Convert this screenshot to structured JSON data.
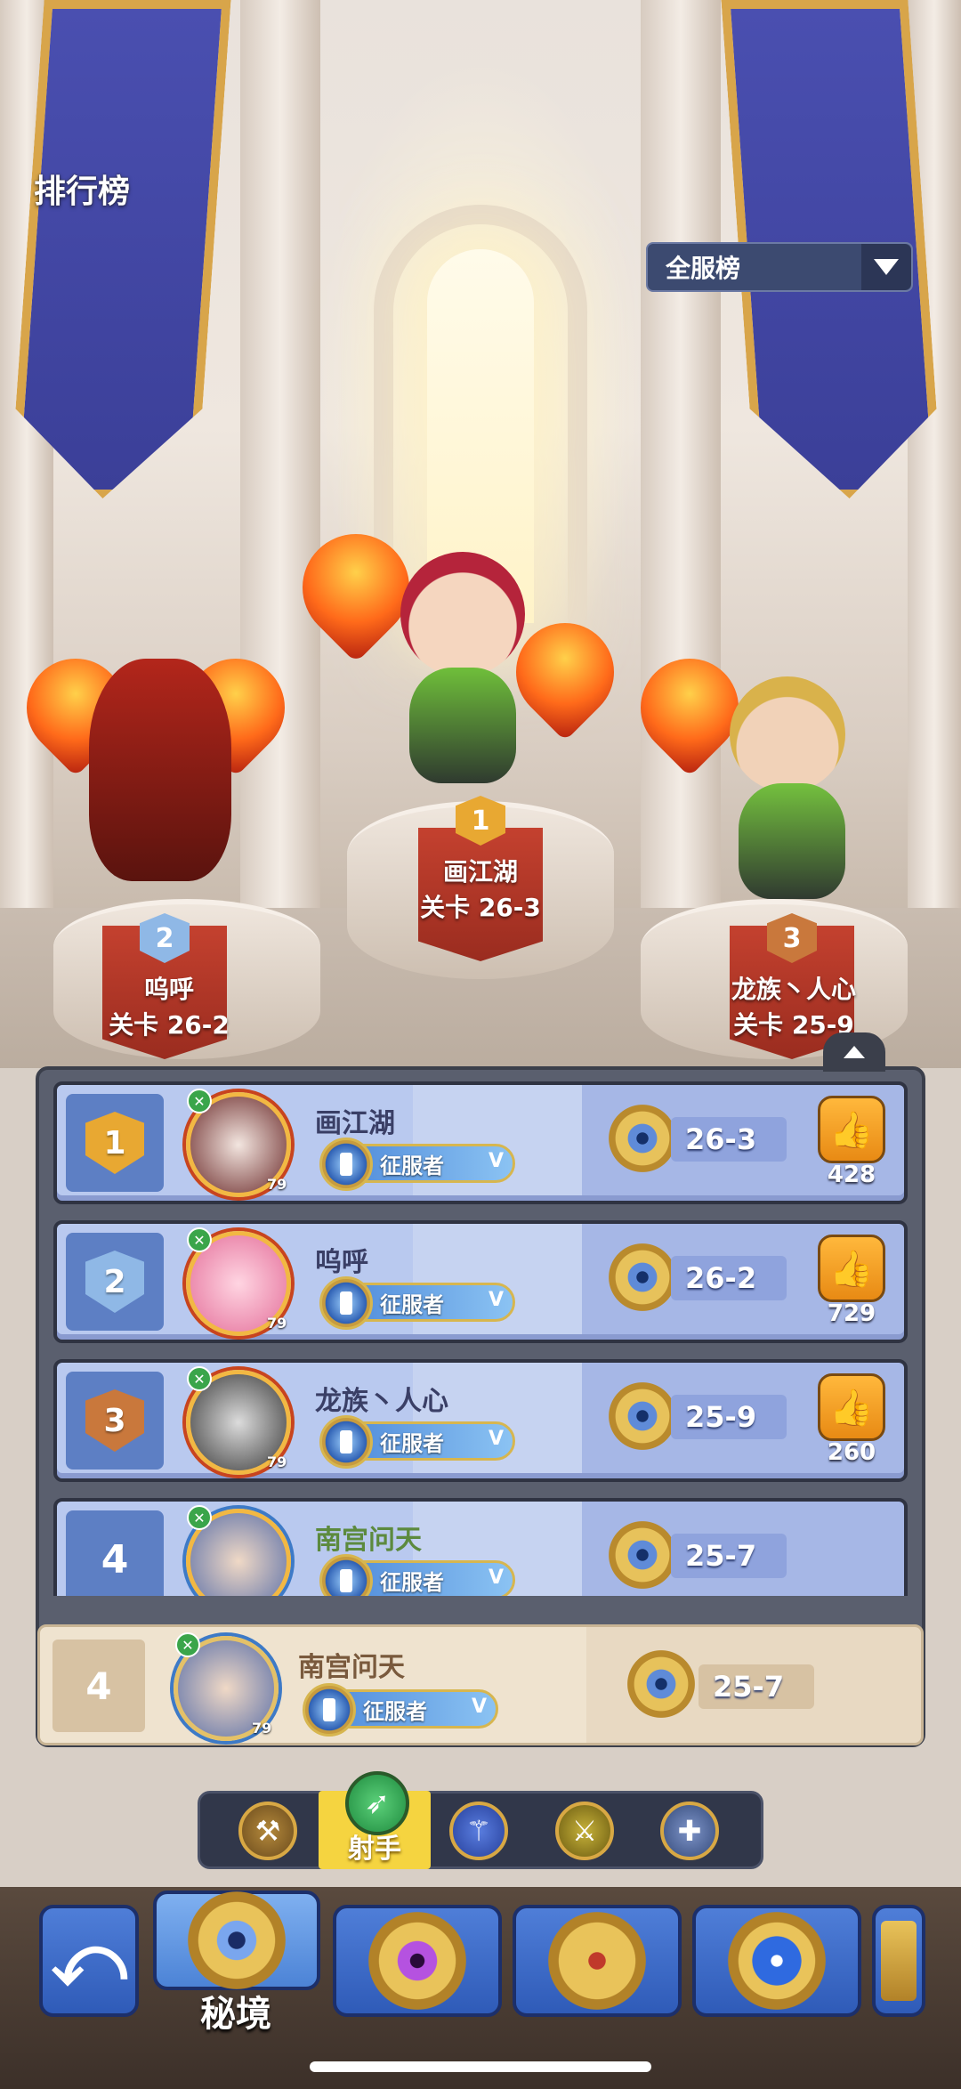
{
  "header": {
    "title": "排行榜",
    "scope_select": {
      "selected": "全服榜"
    }
  },
  "podium": [
    {
      "rank": "1",
      "name": "画江湖",
      "stage": "关卡 26-3"
    },
    {
      "rank": "2",
      "name": "呜呼",
      "stage": "关卡 26-2"
    },
    {
      "rank": "3",
      "name": "龙族丶人心",
      "stage": "关卡 25-9"
    }
  ],
  "rankings": [
    {
      "rank": "1",
      "name": "画江湖",
      "level": "79",
      "title": "征服者",
      "title_tier": "V",
      "stage": "26-3",
      "likes": "428"
    },
    {
      "rank": "2",
      "name": "呜呼",
      "level": "79",
      "title": "征服者",
      "title_tier": "V",
      "stage": "26-2",
      "likes": "729"
    },
    {
      "rank": "3",
      "name": "龙族丶人心",
      "level": "79",
      "title": "征服者",
      "title_tier": "V",
      "stage": "25-9",
      "likes": "260"
    },
    {
      "rank": "4",
      "name": "南宫问天",
      "level": "79",
      "title": "征服者",
      "title_tier": "V",
      "stage": "25-7",
      "likes": ""
    }
  ],
  "self_row": {
    "rank": "4",
    "name": "南宫问天",
    "level": "79",
    "title": "征服者",
    "title_tier": "V",
    "stage": "25-7"
  },
  "class_tabs": {
    "active_label": "射手",
    "tabs": [
      {
        "icon": "axe-icon"
      },
      {
        "icon": "bow-icon",
        "active": true
      },
      {
        "icon": "staff-icon"
      },
      {
        "icon": "sword-icon"
      },
      {
        "icon": "cross-icon"
      }
    ]
  },
  "bottom_nav": {
    "active_label": "秘境",
    "items": [
      {
        "icon": "back-arrow-icon"
      },
      {
        "icon": "secret-realm-emblem-icon",
        "active": true
      },
      {
        "icon": "purple-gem-emblem-icon"
      },
      {
        "icon": "crown-emblem-icon"
      },
      {
        "icon": "star-emblem-icon"
      },
      {
        "icon": "partial-emblem-icon"
      }
    ]
  },
  "colors": {
    "rank1": "#e8a832",
    "rank2": "#8fb8e6",
    "rank3": "#c9783c",
    "row_bg": "#b9c9ef",
    "self_bg": "#efe3cf",
    "accent_tab": "#f5d440"
  }
}
